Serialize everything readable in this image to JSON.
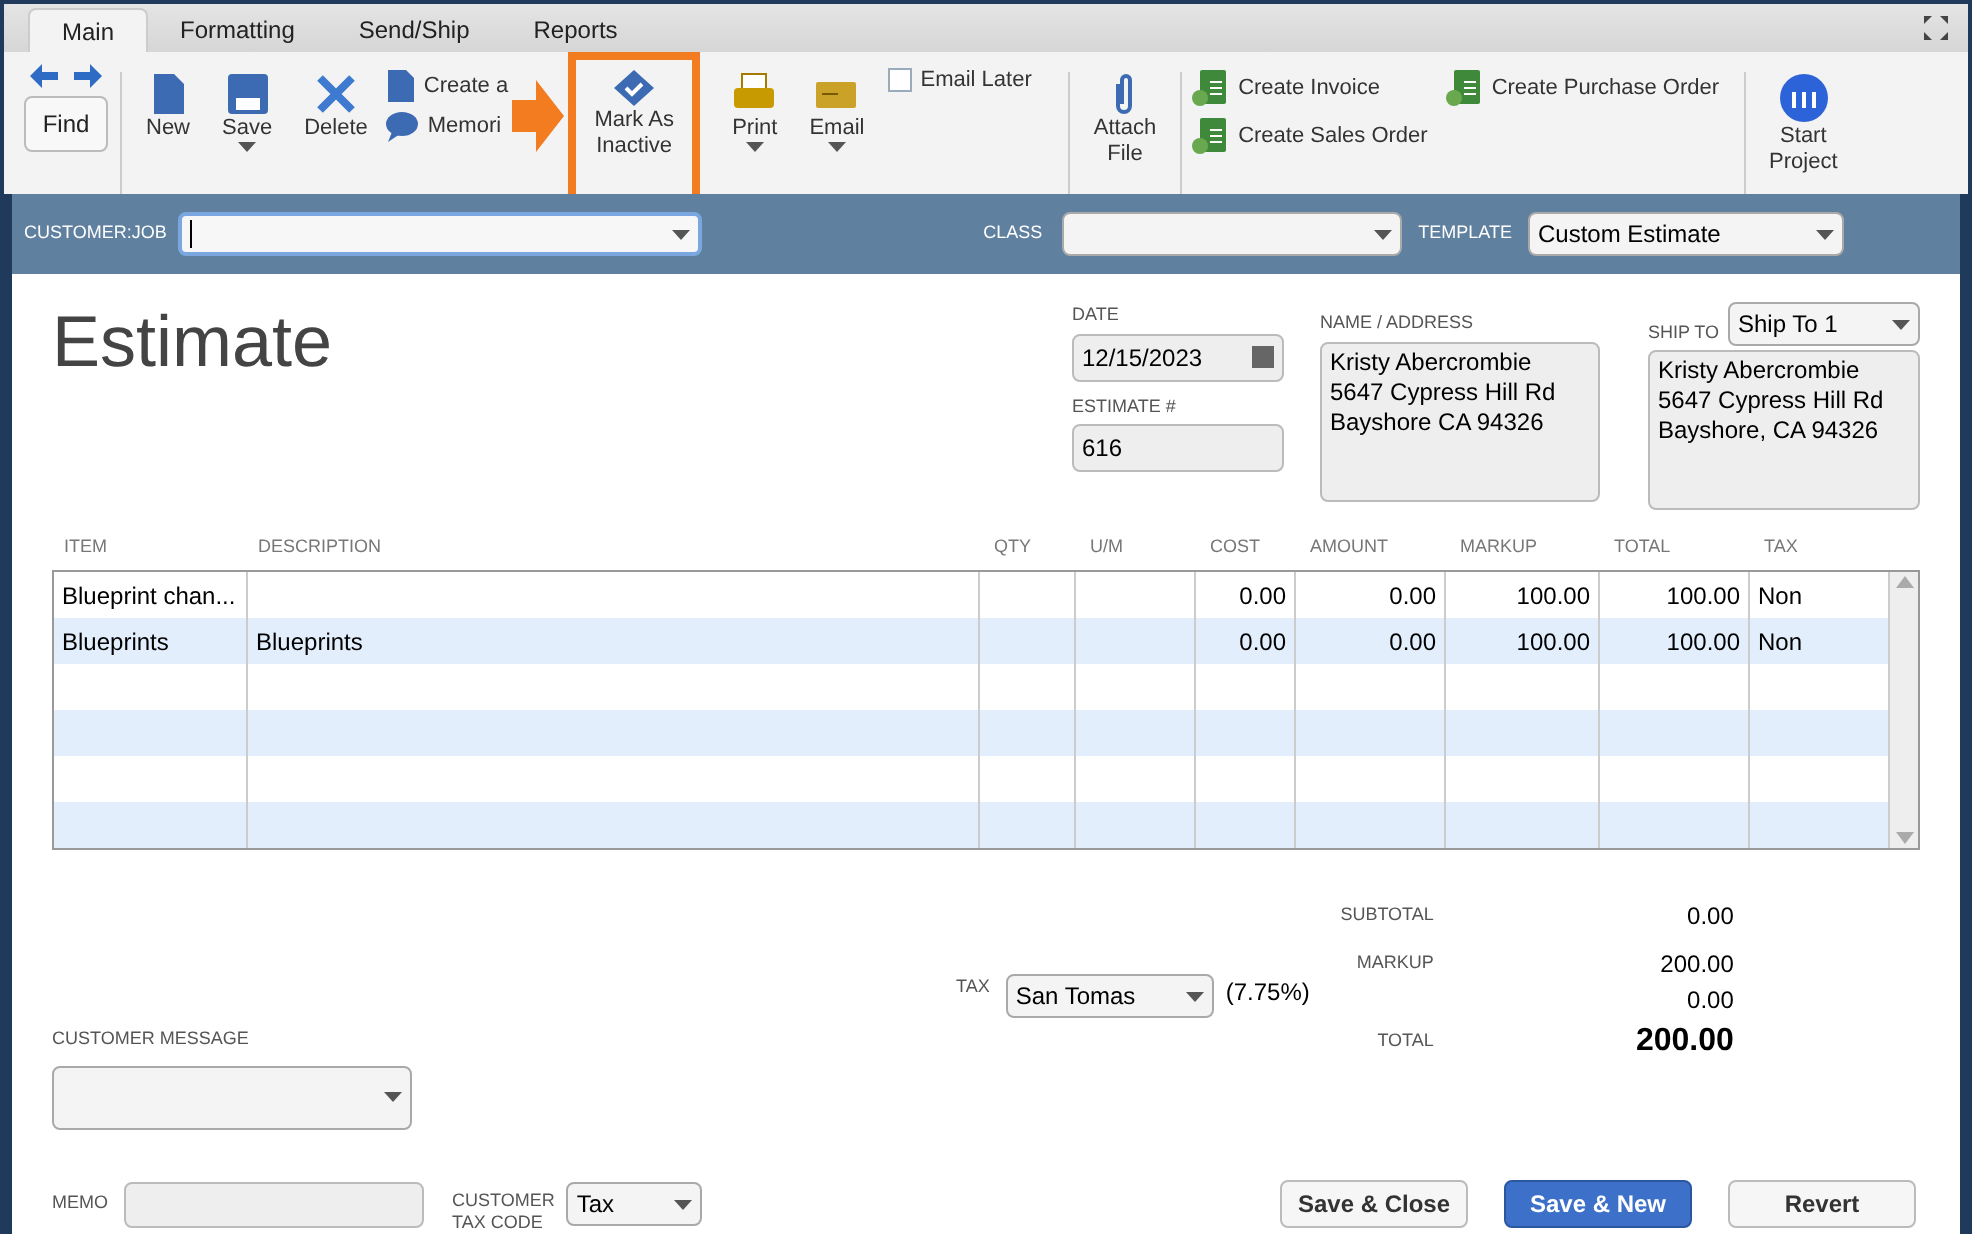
{
  "tabs": [
    {
      "label": "Main",
      "selected": true
    },
    {
      "label": "Formatting",
      "selected": false
    },
    {
      "label": "Send/Ship",
      "selected": false
    },
    {
      "label": "Reports",
      "selected": false
    }
  ],
  "toolbar": {
    "find": "Find",
    "new": "New",
    "save": "Save",
    "delete": "Delete",
    "create_copy": "Create a",
    "memorize": "Memori",
    "mark_inactive": [
      "Mark As",
      "Inactive"
    ],
    "print": "Print",
    "email": "Email",
    "email_later": {
      "label": "Email Later",
      "checked": false
    },
    "attach": [
      "Attach",
      "File"
    ],
    "create_invoice": "Create Invoice",
    "create_sales_order": "Create Sales Order",
    "create_po": "Create Purchase Order",
    "start_project": [
      "Start",
      "Project"
    ]
  },
  "header": {
    "customer_job_label": "CUSTOMER:JOB",
    "class_label": "CLASS",
    "template_label": "TEMPLATE",
    "template_value": "Custom Estimate"
  },
  "form": {
    "title": "Estimate",
    "date_label": "DATE",
    "date": "12/15/2023",
    "estimate_no_label": "ESTIMATE #",
    "estimate_no": "616",
    "name_address_label": "NAME / ADDRESS",
    "name_address": [
      "Kristy Abercrombie",
      "5647 Cypress Hill Rd",
      "Bayshore CA 94326"
    ],
    "ship_to_label": "SHIP TO",
    "ship_to_value": "Ship To 1",
    "ship_to": [
      "Kristy Abercrombie",
      "5647 Cypress Hill Rd",
      "Bayshore, CA 94326"
    ]
  },
  "table": {
    "columns": [
      "ITEM",
      "DESCRIPTION",
      "QTY",
      "U/M",
      "COST",
      "AMOUNT",
      "MARKUP",
      "TOTAL",
      "TAX"
    ],
    "rows": [
      [
        "Blueprint chan...",
        "",
        "",
        "",
        "0.00",
        "0.00",
        "100.00",
        "100.00",
        "Non"
      ],
      [
        "Blueprints",
        "Blueprints",
        "",
        "",
        "0.00",
        "0.00",
        "100.00",
        "100.00",
        "Non"
      ]
    ]
  },
  "totals": {
    "subtotal_label": "SUBTOTAL",
    "subtotal": "0.00",
    "markup_label": "MARKUP",
    "markup": "200.00",
    "tax_label": "TAX",
    "tax_item": "San Tomas",
    "tax_rate": "(7.75%)",
    "tax": "0.00",
    "total_label": "TOTAL",
    "total": "200.00"
  },
  "footer": {
    "customer_message_label": "CUSTOMER MESSAGE",
    "memo_label": "MEMO",
    "tax_code_label": [
      "CUSTOMER",
      "TAX CODE"
    ],
    "tax_code": "Tax",
    "buttons": [
      {
        "label": "Save & Close",
        "kind": "normal"
      },
      {
        "label": "Save & New",
        "kind": "primary"
      },
      {
        "label": "Revert",
        "kind": "normal"
      }
    ]
  }
}
